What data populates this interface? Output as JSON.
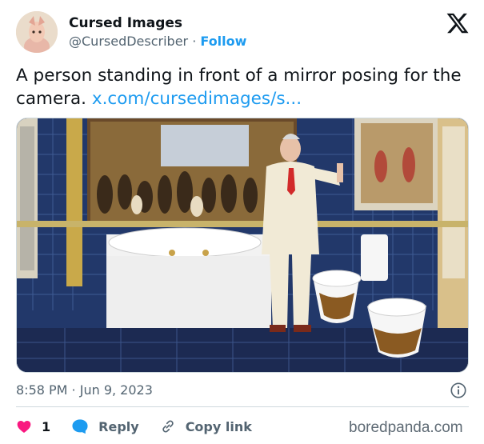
{
  "tweet": {
    "author": {
      "display_name": "Cursed Images",
      "handle": "@CursedDescriber",
      "separator": "·",
      "follow_label": "Follow"
    },
    "text": "A person standing in front of a mirror posing for the camera.",
    "link": "x.com/cursedimages/s...",
    "timestamp": "8:58 PM · Jun 9, 2023",
    "actions": {
      "like_count": "1",
      "reply_label": "Reply",
      "copy_link_label": "Copy link"
    }
  },
  "watermark": "boredpanda.com",
  "icons": [
    "x-logo-icon",
    "info-icon",
    "heart-icon",
    "reply-bubble-icon",
    "link-icon"
  ],
  "colors": {
    "link": "#1d9bf0",
    "text": "#0f1419",
    "secondary": "#536471",
    "like": "#f91880",
    "divider": "#cfd9de"
  }
}
